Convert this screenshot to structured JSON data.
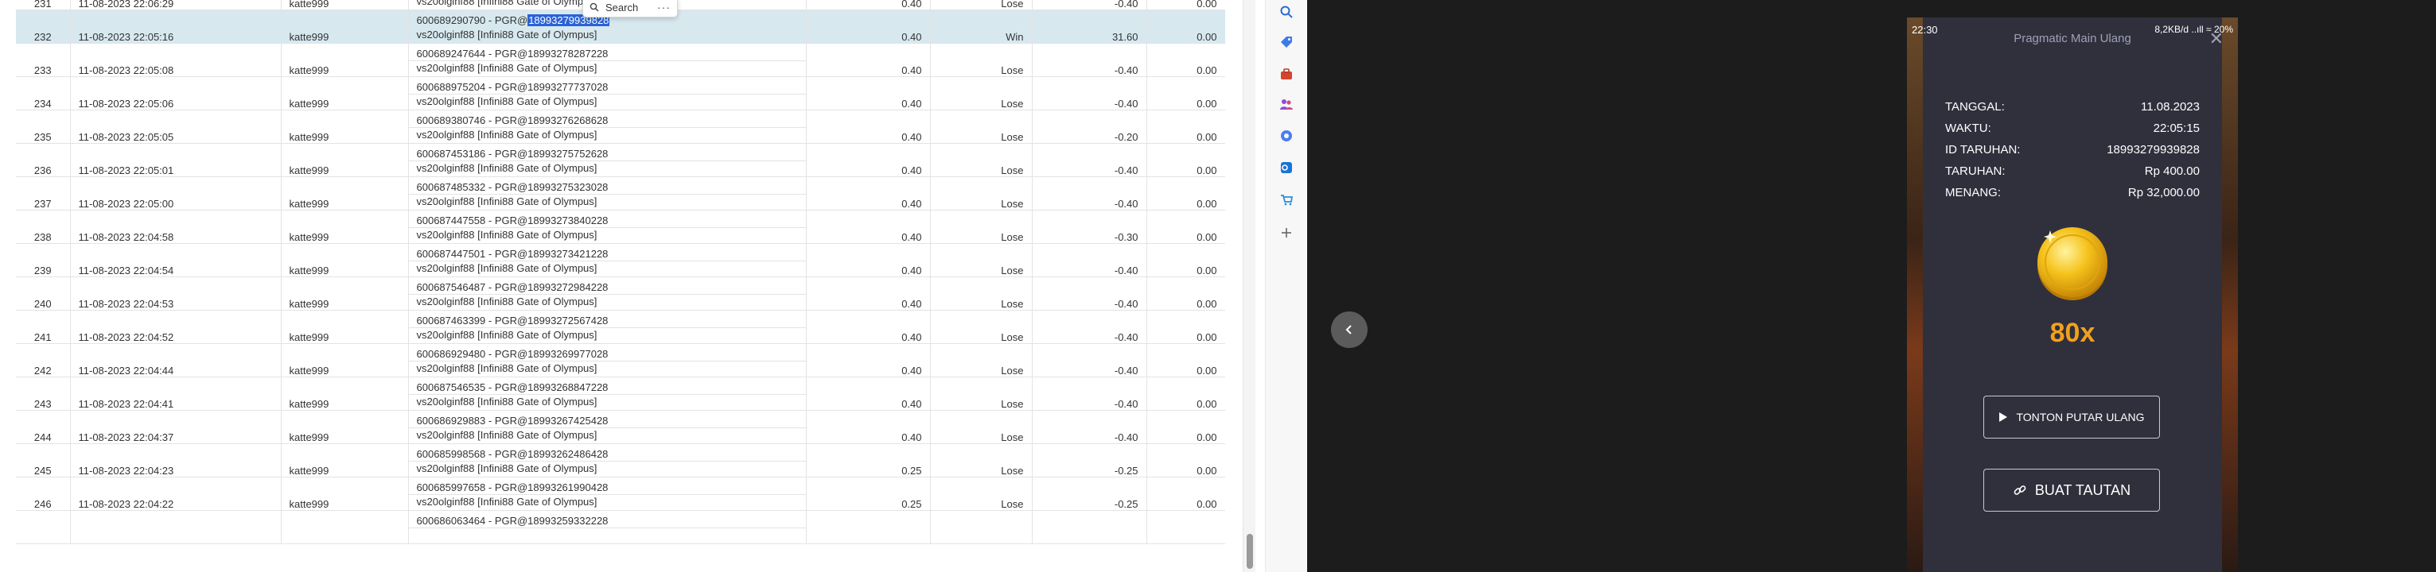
{
  "find_popup": {
    "label": "Search",
    "more": "···"
  },
  "rows": [
    {
      "no": "231",
      "date": "11-08-2023 22:06:29",
      "user": "katte999",
      "line1": "",
      "line2": "vs20olginf88 [Infini88 Gate of Olympus]",
      "stake": "0.40",
      "result": "Lose",
      "pl": "-0.40",
      "last": "0.00",
      "partial": true
    },
    {
      "no": "232",
      "date": "11-08-2023 22:05:16",
      "user": "katte999",
      "line1": "600689290790 - PGR@",
      "line1_sel": "18993279939828",
      "line2": "vs20olginf88 [Infini88 Gate of Olympus]",
      "stake": "0.40",
      "result": "Win",
      "pl": "31.60",
      "last": "0.00",
      "hl": true
    },
    {
      "no": "233",
      "date": "11-08-2023 22:05:08",
      "user": "katte999",
      "line1": "600689247644 - PGR@18993278287228",
      "line2": "vs20olginf88 [Infini88 Gate of Olympus]",
      "stake": "0.40",
      "result": "Lose",
      "pl": "-0.40",
      "last": "0.00"
    },
    {
      "no": "234",
      "date": "11-08-2023 22:05:06",
      "user": "katte999",
      "line1": "600688975204 - PGR@18993277737028",
      "line2": "vs20olginf88 [Infini88 Gate of Olympus]",
      "stake": "0.40",
      "result": "Lose",
      "pl": "-0.40",
      "last": "0.00"
    },
    {
      "no": "235",
      "date": "11-08-2023 22:05:05",
      "user": "katte999",
      "line1": "600689380746 - PGR@18993276268628",
      "line2": "vs20olginf88 [Infini88 Gate of Olympus]",
      "stake": "0.40",
      "result": "Lose",
      "pl": "-0.20",
      "last": "0.00"
    },
    {
      "no": "236",
      "date": "11-08-2023 22:05:01",
      "user": "katte999",
      "line1": "600687453186 - PGR@18993275752628",
      "line2": "vs20olginf88 [Infini88 Gate of Olympus]",
      "stake": "0.40",
      "result": "Lose",
      "pl": "-0.40",
      "last": "0.00"
    },
    {
      "no": "237",
      "date": "11-08-2023 22:05:00",
      "user": "katte999",
      "line1": "600687485332 - PGR@18993275323028",
      "line2": "vs20olginf88 [Infini88 Gate of Olympus]",
      "stake": "0.40",
      "result": "Lose",
      "pl": "-0.40",
      "last": "0.00"
    },
    {
      "no": "238",
      "date": "11-08-2023 22:04:58",
      "user": "katte999",
      "line1": "600687447558 - PGR@18993273840228",
      "line2": "vs20olginf88 [Infini88 Gate of Olympus]",
      "stake": "0.40",
      "result": "Lose",
      "pl": "-0.30",
      "last": "0.00"
    },
    {
      "no": "239",
      "date": "11-08-2023 22:04:54",
      "user": "katte999",
      "line1": "600687447501 - PGR@18993273421228",
      "line2": "vs20olginf88 [Infini88 Gate of Olympus]",
      "stake": "0.40",
      "result": "Lose",
      "pl": "-0.40",
      "last": "0.00"
    },
    {
      "no": "240",
      "date": "11-08-2023 22:04:53",
      "user": "katte999",
      "line1": "600687546487 - PGR@18993272984228",
      "line2": "vs20olginf88 [Infini88 Gate of Olympus]",
      "stake": "0.40",
      "result": "Lose",
      "pl": "-0.40",
      "last": "0.00"
    },
    {
      "no": "241",
      "date": "11-08-2023 22:04:52",
      "user": "katte999",
      "line1": "600687463399 - PGR@18993272567428",
      "line2": "vs20olginf88 [Infini88 Gate of Olympus]",
      "stake": "0.40",
      "result": "Lose",
      "pl": "-0.40",
      "last": "0.00"
    },
    {
      "no": "242",
      "date": "11-08-2023 22:04:44",
      "user": "katte999",
      "line1": "600686929480 - PGR@18993269977028",
      "line2": "vs20olginf88 [Infini88 Gate of Olympus]",
      "stake": "0.40",
      "result": "Lose",
      "pl": "-0.40",
      "last": "0.00"
    },
    {
      "no": "243",
      "date": "11-08-2023 22:04:41",
      "user": "katte999",
      "line1": "600687546535 - PGR@18993268847228",
      "line2": "vs20olginf88 [Infini88 Gate of Olympus]",
      "stake": "0.40",
      "result": "Lose",
      "pl": "-0.40",
      "last": "0.00"
    },
    {
      "no": "244",
      "date": "11-08-2023 22:04:37",
      "user": "katte999",
      "line1": "600686929883 - PGR@18993267425428",
      "line2": "vs20olginf88 [Infini88 Gate of Olympus]",
      "stake": "0.40",
      "result": "Lose",
      "pl": "-0.40",
      "last": "0.00"
    },
    {
      "no": "245",
      "date": "11-08-2023 22:04:23",
      "user": "katte999",
      "line1": "600685998568 - PGR@18993262486428",
      "line2": "vs20olginf88 [Infini88 Gate of Olympus]",
      "stake": "0.25",
      "result": "Lose",
      "pl": "-0.25",
      "last": "0.00"
    },
    {
      "no": "246",
      "date": "11-08-2023 22:04:22",
      "user": "katte999",
      "line1": "600685997658 - PGR@18993261990428",
      "line2": "vs20olginf88 [Infini88 Gate of Olympus]",
      "stake": "0.25",
      "result": "Lose",
      "pl": "-0.25",
      "last": "0.00"
    },
    {
      "no": "",
      "date": "",
      "user": "",
      "line1": "600686063464 - PGR@18993259332228",
      "line2": "",
      "stake": "",
      "result": "",
      "pl": "",
      "last": "",
      "partial_bottom": true
    }
  ],
  "sidebar_icons": [
    "search-icon",
    "tag-icon",
    "toolbox-icon",
    "people-icon",
    "copilot-icon",
    "outlook-icon",
    "shopping-icon",
    "add-icon"
  ],
  "phone": {
    "status_time": "22:30",
    "status_right": "8,2KB/d ..ıll ≈ 20%",
    "title": "Pragmatic Main Ulang",
    "close": "✕",
    "fields": [
      {
        "key": "TANGGAL:",
        "value": "11.08.2023"
      },
      {
        "key": "WAKTU:",
        "value": "22:05:15"
      },
      {
        "key": "ID TARUHAN:",
        "value": "18993279939828"
      },
      {
        "key": "TARUHAN:",
        "value": "Rp 400.00"
      },
      {
        "key": "MENANG:",
        "value": "Rp 32,000.00"
      }
    ],
    "multiplier": "80x",
    "replay_label": "TONTON PUTAR ULANG",
    "link_label": "BUAT TAUTAN"
  },
  "colors": {
    "win": "#1f9d3a",
    "lose": "#e02424",
    "highlight": "#d7e9ef",
    "selection": "#2b62d6",
    "multiplier": "#f2a11c"
  }
}
